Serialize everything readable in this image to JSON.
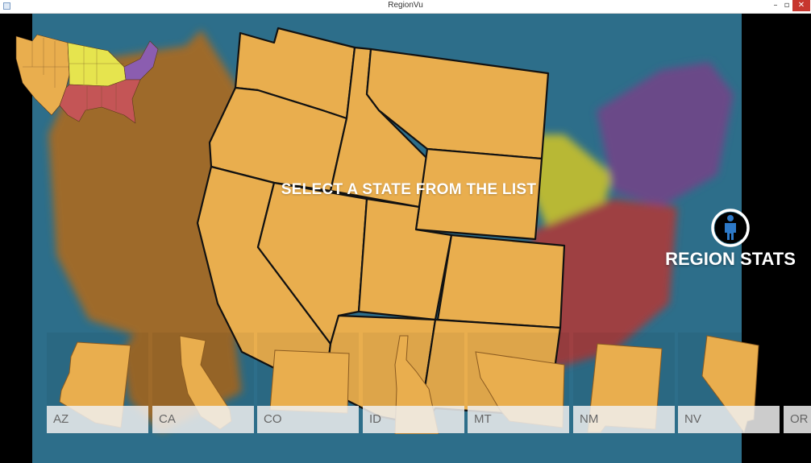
{
  "window": {
    "title": "RegionVu",
    "minimize_glyph": "–",
    "maximize_glyph": "▫",
    "close_glyph": "✕"
  },
  "prompt": "SELECT A STATE FROM THE LIST",
  "region_stats": {
    "label": "REGION STATS",
    "icon": "person-icon"
  },
  "states": [
    {
      "abbr": "AZ"
    },
    {
      "abbr": "CA"
    },
    {
      "abbr": "CO"
    },
    {
      "abbr": "ID"
    },
    {
      "abbr": "MT"
    },
    {
      "abbr": "NM"
    },
    {
      "abbr": "NV"
    },
    {
      "abbr": "OR"
    }
  ],
  "colors": {
    "west": "#E9AE4E",
    "midwest": "#E6E44E",
    "northeast": "#8B5DB0",
    "south": "#C45556",
    "ocean": "#2D6E8A",
    "outline": "#111111",
    "accent_blue": "#2D79C7"
  }
}
